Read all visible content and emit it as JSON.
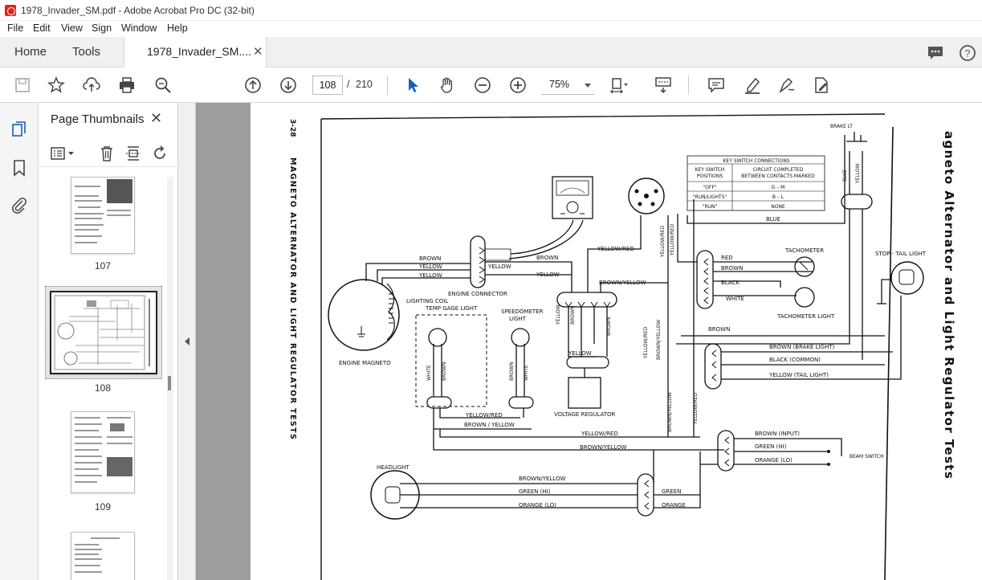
{
  "window": {
    "title": "1978_Invader_SM.pdf - Adobe Acrobat Pro DC (32-bit)"
  },
  "menu": [
    "File",
    "Edit",
    "View",
    "Sign",
    "Window",
    "Help"
  ],
  "tabs": {
    "home": "Home",
    "tools": "Tools",
    "document": "1978_Invader_SM...."
  },
  "toolbar": {
    "page_current": "108",
    "page_separator": "/",
    "page_total": "210",
    "zoom": "75%"
  },
  "thumbnails": {
    "title": "Page Thumbnails",
    "pages": [
      {
        "label": "107"
      },
      {
        "label": "108"
      },
      {
        "label": "109"
      },
      {
        "label": ""
      }
    ]
  },
  "doc": {
    "page_number": "3-28",
    "left_title": "MAGNETO ALTERNATOR AND LIGHT REGULATOR TESTS",
    "right_title": "agneto Alternator and Light Regulator Tests",
    "table": {
      "title": "KEY SWITCH CONNECTIONS",
      "head_left": [
        "KEY SWITCH",
        "POSITIONS"
      ],
      "head_right": [
        "CIRCUIT COMPLETED",
        "BETWEEN CONTACTS MARKED"
      ],
      "rows": [
        {
          "pos": "\"OFF\"",
          "circuit": "G – M"
        },
        {
          "pos": "\"RUN/LIGHTS\"",
          "circuit": "B – L"
        },
        {
          "pos": "\"RUN\"",
          "circuit": "NONE"
        }
      ]
    },
    "labels": {
      "brake_lt": "BRAKE LT",
      "blue": "BLUE",
      "yellow": "YELLOW",
      "stop_tail": "STOP - TAIL LIGHT",
      "tachometer": "TACHOMETER",
      "tach_light": "TACHOMETER LIGHT",
      "red": "RED",
      "brown": "BROWN",
      "black": "BLACK",
      "white": "WHITE",
      "yellow_red": "YELLOW/RED",
      "brown_yellow": "BROWN/YELLOW",
      "engine_connector": "ENGINE CONNECTOR",
      "lighting_coil": "LIGHTING COIL",
      "engine_magneto": "ENGINE MAGNETO",
      "temp_gage": "TEMP GAGE LIGHT",
      "speedometer": "SPEEDOMETER",
      "light": "LIGHT",
      "voltage_regulator": "VOLTAGE REGULATOR",
      "brown_brake": "BROWN (BRAKE LIGHT)",
      "black_common": "BLACK (COMMON)",
      "yellow_tail": "YELLOW (TAIL LIGHT)",
      "brown_input": "BROWN (INPUT)",
      "green_hi_cap": "GREEN (HI)",
      "orange_lo_cap": "ORANGE (LO)",
      "beam_switch": "BEAM SWITCH",
      "headlight": "HEADLIGHT",
      "green_hi": "GREEN (HI)",
      "orange_lo": "ORANGE (LO)",
      "green": "GREEN",
      "orange": "ORANGE",
      "brown_slash_yellow": "BROWN / YELLOW"
    }
  }
}
